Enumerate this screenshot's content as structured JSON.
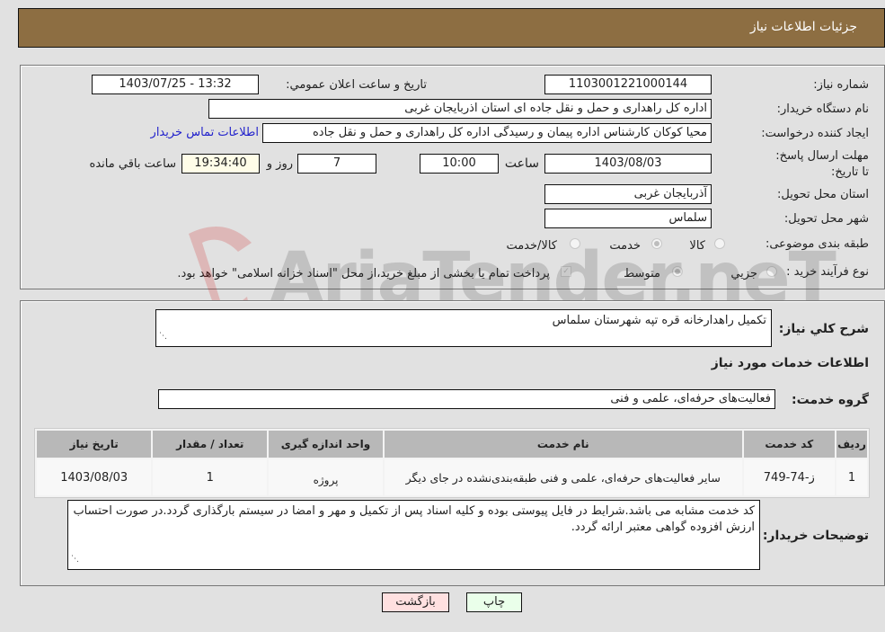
{
  "header": {
    "title": "جزئیات اطلاعات نیاز"
  },
  "form": {
    "need_number": {
      "label": "شماره نیاز:",
      "value": "1103001221000144"
    },
    "announce_datetime": {
      "label": "تاریخ و ساعت اعلان عمومي:",
      "value": "1403/07/25 - 13:32"
    },
    "buyer_org": {
      "label": "نام دستگاه خریدار:",
      "value": "اداره کل راهداری و حمل و نقل جاده ای استان اذربایجان غربی"
    },
    "requester": {
      "label": "ایجاد کننده درخواست:",
      "value": "محیا کوکان کارشناس اداره پیمان و رسیدگی اداره کل راهداری و حمل و نقل جاده",
      "contact_link": "اطلاعات تماس خریدار"
    },
    "deadline": {
      "label": "مهلت ارسال پاسخ: تا تاریخ:",
      "date": "1403/08/03",
      "time_label": "ساعت",
      "time": "10:00",
      "days": "7",
      "days_label": "روز و",
      "remaining": "19:34:40",
      "remaining_label": "ساعت باقي مانده"
    },
    "delivery_province": {
      "label": "استان محل تحویل:",
      "value": "آذربایجان غربی"
    },
    "delivery_city": {
      "label": "شهر محل تحویل:",
      "value": "سلماس"
    },
    "category": {
      "label": "طبقه بندی موضوعی:",
      "options": [
        "کالا",
        "خدمت",
        "کالا/خدمت"
      ],
      "selected": "خدمت"
    },
    "purchase_process": {
      "label": "نوع فرآیند خرید :",
      "options": [
        "جزيي",
        "متوسط"
      ],
      "selected": "متوسط",
      "treasury_note": "پرداخت تمام یا بخشی از مبلغ خرید،از محل \"اسناد خزانه اسلامی\" خواهد بود."
    }
  },
  "details": {
    "summary_label": "شرح کلي نیاز:",
    "summary_value": "تکمیل راهدارخانه قره تپه شهرستان سلماس",
    "services_heading": "اطلاعات خدمات مورد نیاز",
    "service_group_label": "گروه خدمت:",
    "service_group_value": "فعالیت‌های حرفه‌ای، علمی و فنی",
    "table": {
      "headers": [
        "ردیف",
        "کد خدمت",
        "نام خدمت",
        "واحد اندازه گیری",
        "تعداد / مقدار",
        "تاریخ نیاز"
      ],
      "rows": [
        [
          "1",
          "ز-74-749",
          "سایر فعالیت‌های حرفه‌ای، علمی و فنی طبقه‌بندی‌نشده در جای دیگر",
          "پروژه",
          "1",
          "1403/08/03"
        ]
      ]
    },
    "buyer_notes_label": "توضیحات خریدار:",
    "buyer_notes_value": "کد خدمت مشابه می باشد.شرایط در فایل پیوستی بوده و کلیه اسناد پس از تکمیل و مهر و امضا در سیستم بارگذاری گردد.در صورت احتساب ارزش افزوده گواهی معتبر ارائه گردد."
  },
  "buttons": {
    "print": "چاپ",
    "back": "بازگشت"
  },
  "watermark": {
    "text": "AriaTender.neT"
  },
  "colors": {
    "header": "#8d6e42",
    "print_bg": "#eaffea",
    "back_bg": "#ffe0e0",
    "link": "#2222cc"
  }
}
